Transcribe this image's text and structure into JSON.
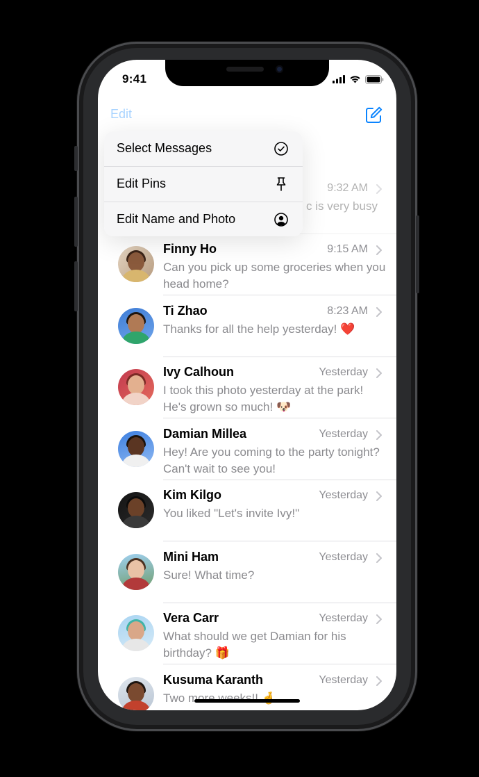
{
  "status_bar": {
    "time": "9:41"
  },
  "nav": {
    "edit_label": "Edit"
  },
  "context_menu": {
    "items": [
      {
        "label": "Select Messages",
        "icon": "checkmark-circle-icon"
      },
      {
        "label": "Edit Pins",
        "icon": "pin-icon"
      },
      {
        "label": "Edit Name and Photo",
        "icon": "person-circle-icon"
      }
    ]
  },
  "partial_row": {
    "time": "9:32 AM",
    "preview": "c is very busy"
  },
  "conversations": [
    {
      "name": "Finny Ho",
      "time": "9:15 AM",
      "preview": "Can you pick up some groceries when you head home?"
    },
    {
      "name": "Ti Zhao",
      "time": "8:23 AM",
      "preview": "Thanks for all the help yesterday!",
      "emoji": "❤️"
    },
    {
      "name": "Ivy Calhoun",
      "time": "Yesterday",
      "preview": "I took this photo yesterday at the park! He's grown so much!",
      "emoji": "🐶"
    },
    {
      "name": "Damian Millea",
      "time": "Yesterday",
      "preview": "Hey! Are you coming to the party tonight? Can't wait to see you!"
    },
    {
      "name": "Kim Kilgo",
      "time": "Yesterday",
      "preview": "You liked \"Let's invite Ivy!\""
    },
    {
      "name": "Mini Ham",
      "time": "Yesterday",
      "preview": "Sure! What time?"
    },
    {
      "name": "Vera Carr",
      "time": "Yesterday",
      "preview": "What should we get Damian for his birthday?",
      "emoji": "🎁"
    },
    {
      "name": "Kusuma Karanth",
      "time": "Yesterday",
      "preview": "Two more weeks!!",
      "emoji": "🤞"
    }
  ],
  "colors": {
    "accent": "#0a84ff",
    "secondary_text": "#8e8e93",
    "heart": "#e0101e"
  }
}
